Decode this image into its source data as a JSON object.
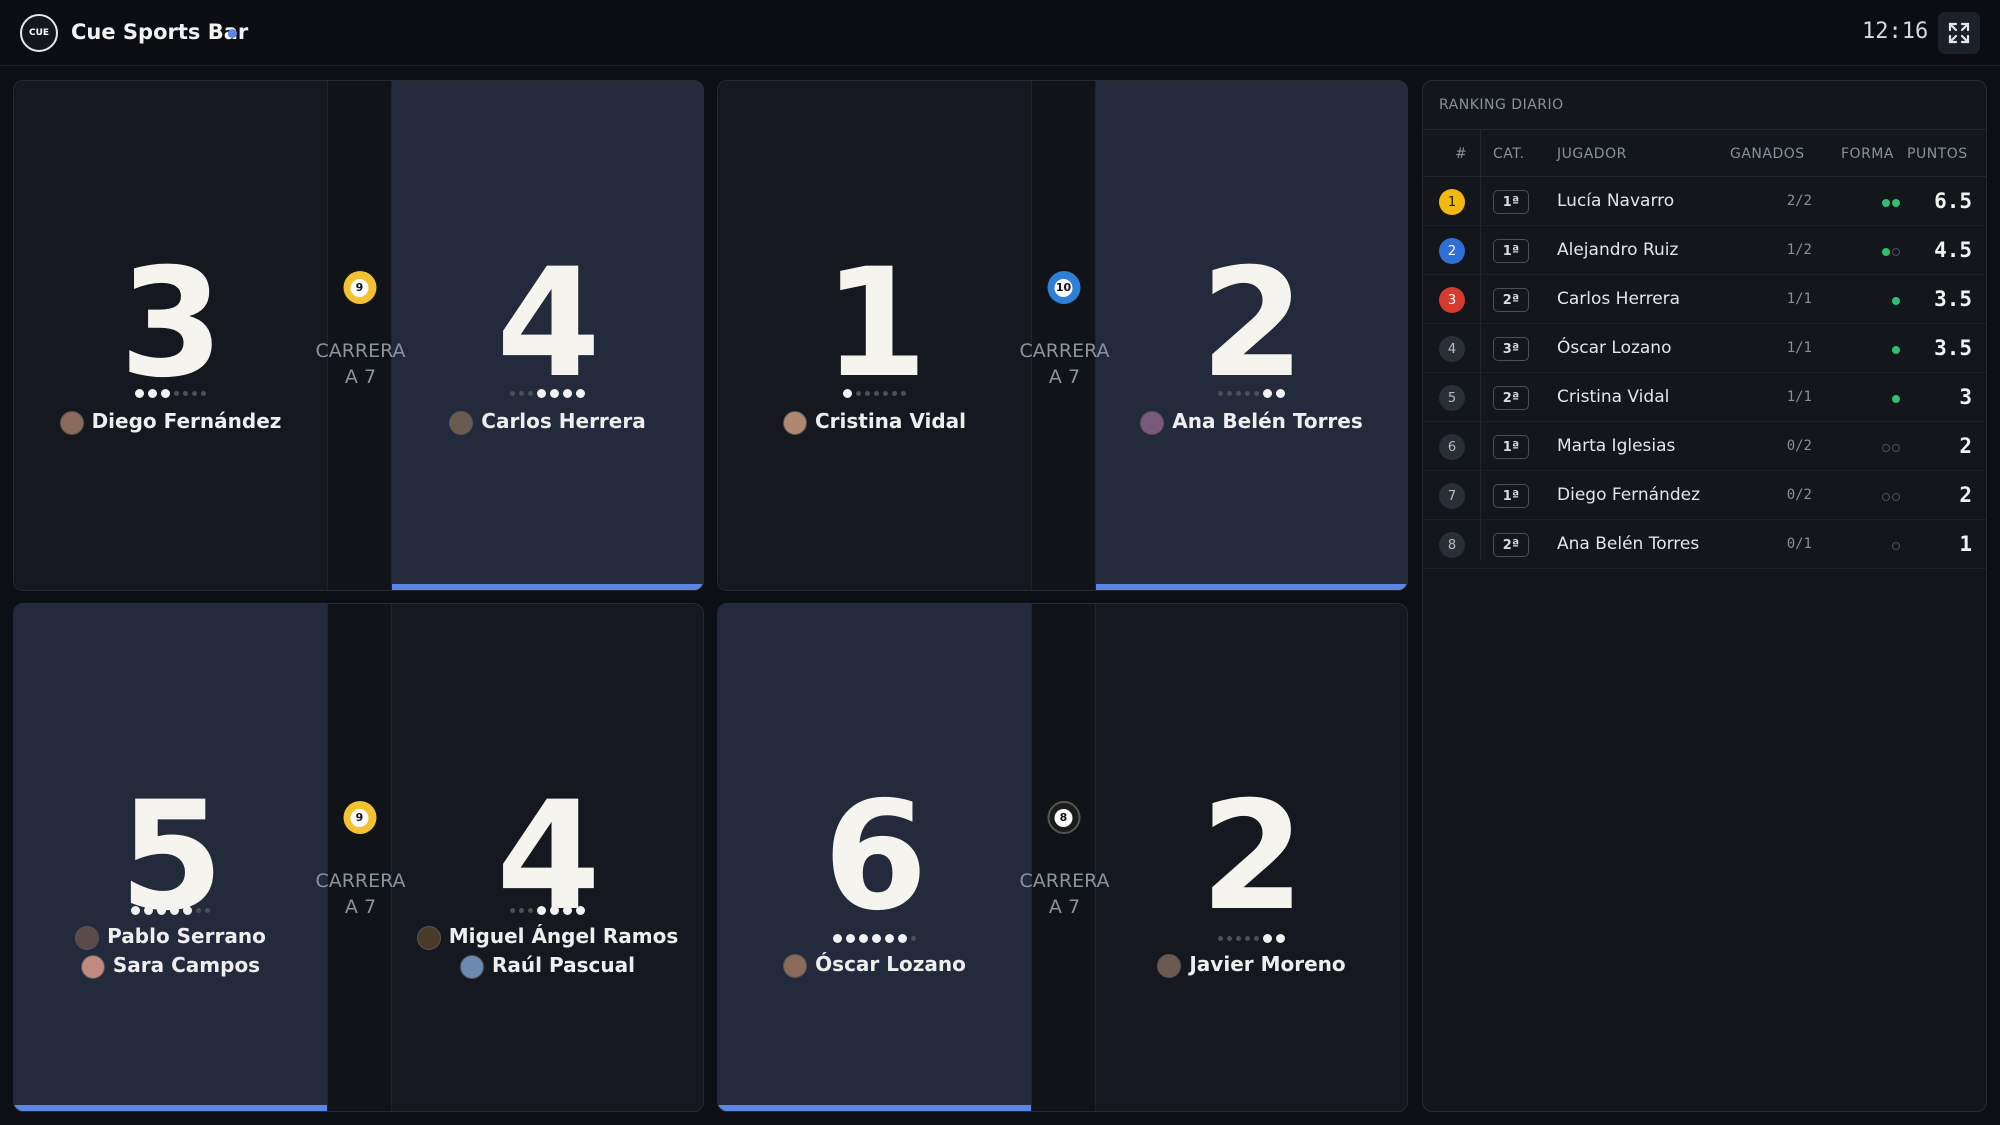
{
  "header": {
    "logo_text": "CUE",
    "brand": "Cue Sports Bar",
    "clock": "12:16"
  },
  "colors": {
    "accent": "#5b86e5",
    "active_half": "#232a3b",
    "win_dot": "#2fbf71",
    "rank1": "#f2b90f",
    "rank2": "#2f6fd6",
    "rank3": "#d63b30"
  },
  "tables": [
    {
      "ball": "9",
      "ball_style": "yellow",
      "race_line1": "CARRERA",
      "race_line2": "A 7",
      "left": {
        "score": "3",
        "active": false,
        "players": [
          "Diego Fernández"
        ],
        "dots_on": 3,
        "dots_total": 7,
        "dots_align": "start"
      },
      "right": {
        "score": "4",
        "active": true,
        "players": [
          "Carlos Herrera"
        ],
        "dots_on": 4,
        "dots_total": 7,
        "dots_align": "end"
      }
    },
    {
      "ball": "10",
      "ball_style": "blue",
      "race_line1": "CARRERA",
      "race_line2": "A 7",
      "left": {
        "score": "1",
        "active": false,
        "players": [
          "Cristina Vidal"
        ],
        "dots_on": 1,
        "dots_total": 7,
        "dots_align": "start"
      },
      "right": {
        "score": "2",
        "active": true,
        "players": [
          "Ana Belén Torres"
        ],
        "dots_on": 2,
        "dots_total": 7,
        "dots_align": "end"
      }
    },
    {
      "ball": "9",
      "ball_style": "yellow",
      "race_line1": "CARRERA",
      "race_line2": "A 7",
      "left": {
        "score": "5",
        "active": true,
        "players": [
          "Pablo Serrano",
          "Sara Campos"
        ],
        "dots_on": 5,
        "dots_total": 7,
        "dots_align": "start"
      },
      "right": {
        "score": "4",
        "active": false,
        "players": [
          "Miguel Ángel Ramos",
          "Raúl Pascual"
        ],
        "dots_on": 4,
        "dots_total": 7,
        "dots_align": "end"
      }
    },
    {
      "ball": "8",
      "ball_style": "black",
      "race_line1": "CARRERA",
      "race_line2": "A 7",
      "left": {
        "score": "6",
        "active": true,
        "players": [
          "Óscar Lozano"
        ],
        "dots_on": 6,
        "dots_total": 7,
        "dots_align": "start"
      },
      "right": {
        "score": "2",
        "active": false,
        "players": [
          "Javier Moreno"
        ],
        "dots_on": 2,
        "dots_total": 7,
        "dots_align": "end"
      }
    }
  ],
  "ranking": {
    "title": "RANKING DIARIO",
    "columns": {
      "pos": "#",
      "cat": "CAT.",
      "player": "JUGADOR",
      "won": "GANADOS",
      "form": "FORMA",
      "points": "PUNTOS"
    },
    "rows": [
      {
        "pos": "1",
        "cat": "1ª",
        "name": "Lucía Navarro",
        "won": "2/2",
        "form": [
          "w",
          "w"
        ],
        "points": "6.5"
      },
      {
        "pos": "2",
        "cat": "1ª",
        "name": "Alejandro Ruiz",
        "won": "1/2",
        "form": [
          "w",
          "l"
        ],
        "points": "4.5"
      },
      {
        "pos": "3",
        "cat": "2ª",
        "name": "Carlos Herrera",
        "won": "1/1",
        "form": [
          "w"
        ],
        "points": "3.5"
      },
      {
        "pos": "4",
        "cat": "3ª",
        "name": "Óscar Lozano",
        "won": "1/1",
        "form": [
          "w"
        ],
        "points": "3.5"
      },
      {
        "pos": "5",
        "cat": "2ª",
        "name": "Cristina Vidal",
        "won": "1/1",
        "form": [
          "w"
        ],
        "points": "3"
      },
      {
        "pos": "6",
        "cat": "1ª",
        "name": "Marta Iglesias",
        "won": "0/2",
        "form": [
          "l",
          "l"
        ],
        "points": "2"
      },
      {
        "pos": "7",
        "cat": "1ª",
        "name": "Diego Fernández",
        "won": "0/2",
        "form": [
          "l",
          "l"
        ],
        "points": "2"
      },
      {
        "pos": "8",
        "cat": "2ª",
        "name": "Ana Belén Torres",
        "won": "0/1",
        "form": [
          "l"
        ],
        "points": "1"
      }
    ]
  }
}
